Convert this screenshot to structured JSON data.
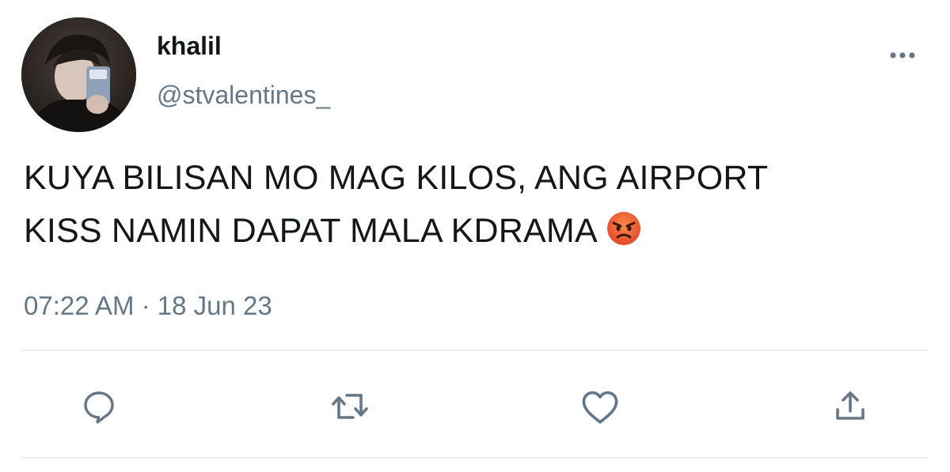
{
  "tweet": {
    "display_name": "khalil",
    "handle": "@stvalentines_",
    "text_lines": [
      "KUYA BILISAN MO MAG KILOS, ANG AIRPORT",
      "KISS NAMIN DAPAT MALA KDRAMA"
    ],
    "emoji": "angry-face",
    "timestamp": "07:22 AM · 18 Jun 23"
  },
  "actions": {
    "icons": [
      "comment-icon",
      "retweet-icon",
      "like-icon",
      "share-icon"
    ]
  },
  "colors": {
    "text_primary": "#14171a",
    "text_secondary": "#657786",
    "icon": "#657786",
    "divider": "#e6ecf0",
    "background": "#ffffff"
  }
}
